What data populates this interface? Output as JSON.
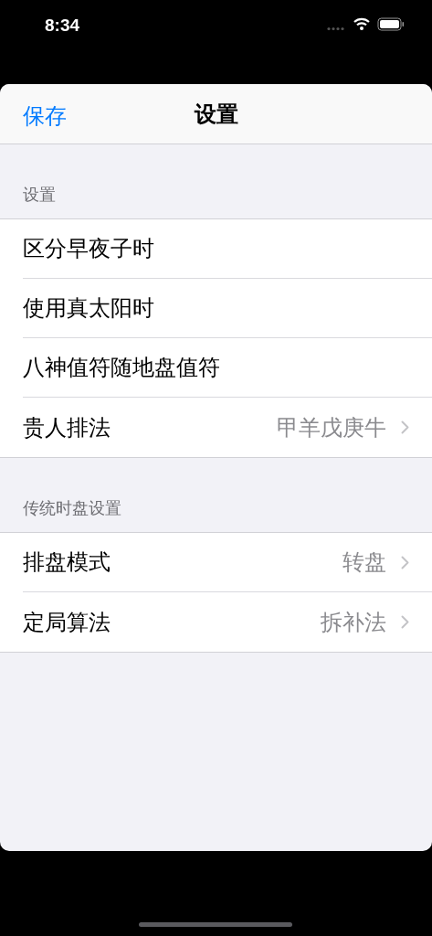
{
  "status_bar": {
    "time": "8:34"
  },
  "nav": {
    "left_button": "保存",
    "title": "设置"
  },
  "sections": [
    {
      "header": "设置",
      "rows": [
        {
          "label": "区分早夜子时"
        },
        {
          "label": "使用真太阳时"
        },
        {
          "label": "八神值符随地盘值符"
        },
        {
          "label": "贵人排法",
          "value": "甲羊戊庚牛"
        }
      ]
    },
    {
      "header": "传统时盘设置",
      "rows": [
        {
          "label": "排盘模式",
          "value": "转盘"
        },
        {
          "label": "定局算法",
          "value": "拆补法"
        }
      ]
    }
  ]
}
